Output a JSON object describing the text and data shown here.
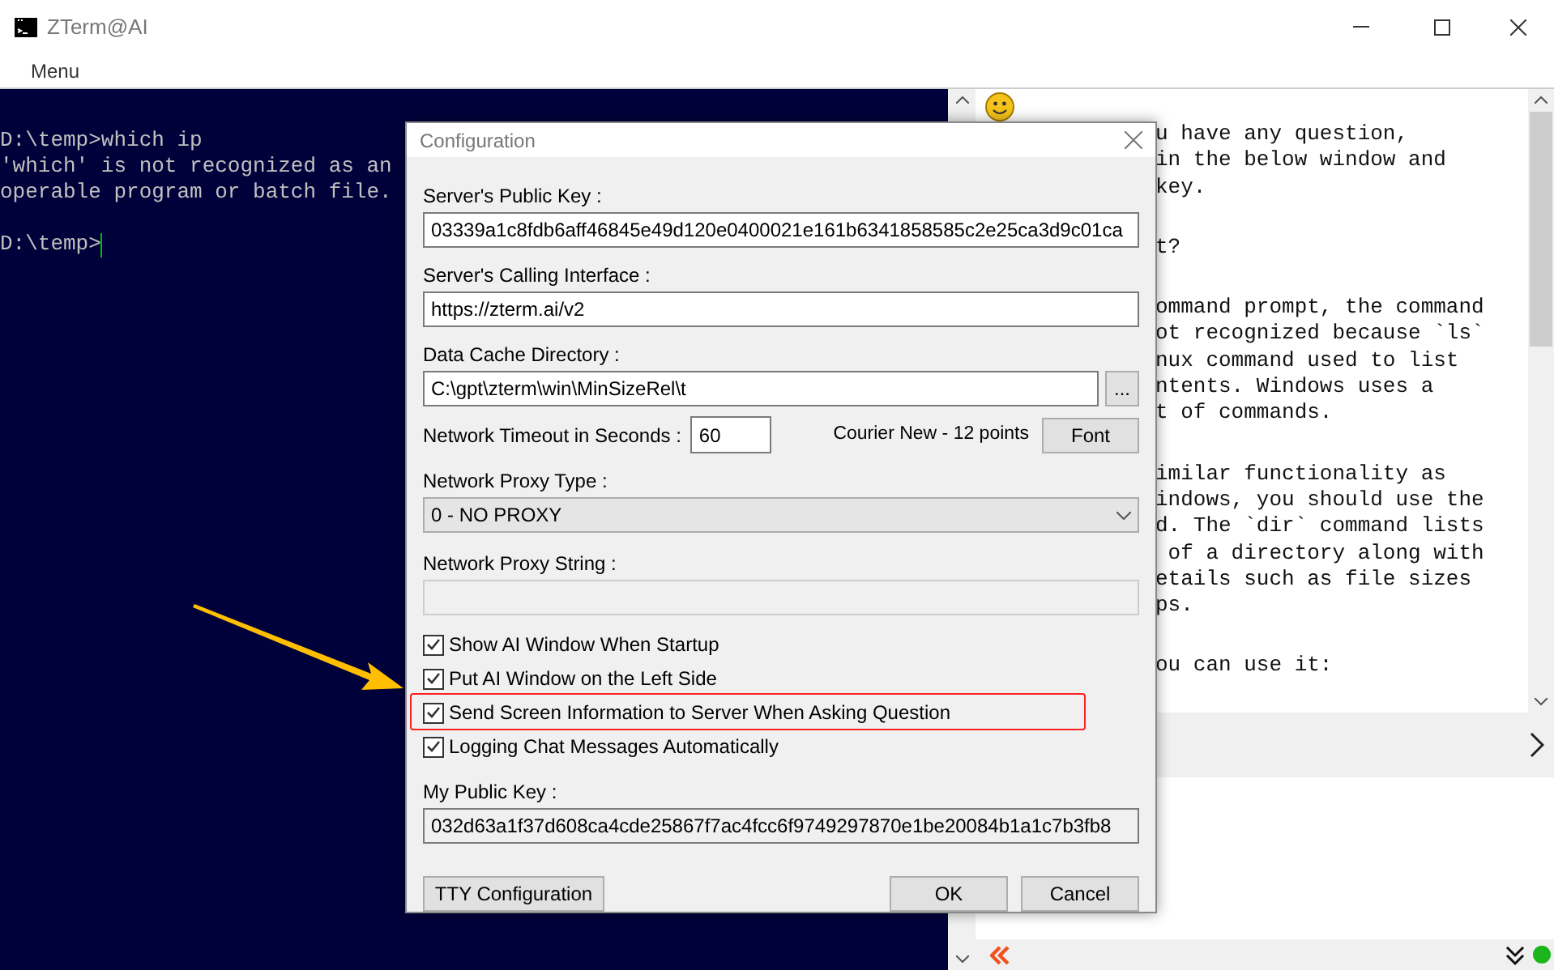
{
  "window": {
    "title": "ZTerm@AI"
  },
  "menu": [
    "Menu"
  ],
  "terminal": {
    "lines": [
      "D:\\temp>which ip",
      "'which' is not recognized as an",
      "operable program or batch file."
    ],
    "prompt": "D:\\temp>"
  },
  "ai_panel": {
    "paragraphs": [
      [
        "u have any question,",
        "in the below window and",
        "key."
      ],
      [
        "t?"
      ],
      [
        "ommand prompt, the command",
        "ot recognized because `ls`",
        "nux command used to list",
        "ntents. Windows uses a",
        "t of commands."
      ],
      [
        "imilar functionality as",
        "indows, you should use the",
        "d. The `dir` command lists",
        " of a directory along with",
        "etails such as file sizes",
        "ps."
      ],
      [
        "ou can use it:"
      ]
    ]
  },
  "dialog": {
    "title": "Configuration",
    "fields": [
      {
        "label": "Server's Public Key :",
        "kind": "text",
        "value": "03339a1c8fdb6aff46845e49d120e0400021e161b6341858585c2e25ca3d9c01ca"
      },
      {
        "label": "Server's Calling Interface :",
        "kind": "text",
        "value": "https://zterm.ai/v2"
      },
      {
        "label": "Data Cache Directory :",
        "kind": "browse",
        "value": "C:\\gpt\\zterm\\win\\MinSizeRel\\t",
        "button": "..."
      }
    ],
    "timeout": {
      "label": "Network Timeout in Seconds :",
      "value": "60"
    },
    "font": {
      "text": "Courier New - 12 points",
      "button": "Font"
    },
    "proxy_type": {
      "label": "Network Proxy Type :",
      "value": "0 - NO PROXY"
    },
    "proxy_string": {
      "label": "Network Proxy String :",
      "disabled": true
    },
    "checkboxes": [
      {
        "label": "Show AI Window When Startup",
        "checked": true,
        "highlighted": false
      },
      {
        "label": "Put AI Window on the Left Side",
        "checked": true,
        "highlighted": false
      },
      {
        "label": "Send Screen Information to Server When Asking Question",
        "checked": true,
        "highlighted": true
      },
      {
        "label": "Logging Chat Messages Automatically",
        "checked": true,
        "highlighted": false
      }
    ],
    "my_key": {
      "label": "My Public Key :",
      "value": "032d63a1f37d608ca4cde25867f7ac4fcc6f9749297870e1be20084b1a1c7b3fb8"
    },
    "buttons": {
      "tty": "TTY Configuration",
      "ok": "OK",
      "cancel": "Cancel"
    }
  }
}
